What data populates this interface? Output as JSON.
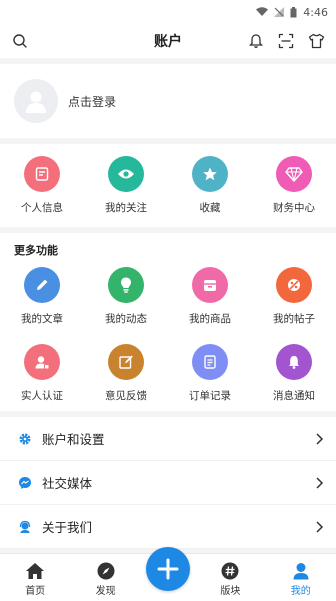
{
  "status_bar": {
    "time": "4:46"
  },
  "header": {
    "title": "账户"
  },
  "login": {
    "prompt": "点击登录"
  },
  "quick_items": [
    {
      "label": "个人信息",
      "icon": "profile-card-icon",
      "color": "#f36f7b"
    },
    {
      "label": "我的关注",
      "icon": "eye-icon",
      "color": "#26b89a"
    },
    {
      "label": "收藏",
      "icon": "star-icon",
      "color": "#4fb3c8"
    },
    {
      "label": "财务中心",
      "icon": "diamond-icon",
      "color": "#f05bb5"
    }
  ],
  "more": {
    "title": "更多功能",
    "row1": [
      {
        "label": "我的文章",
        "icon": "pencil-icon",
        "color": "#4a90e2"
      },
      {
        "label": "我的动态",
        "icon": "lightbulb-icon",
        "color": "#34b36b"
      },
      {
        "label": "我的商品",
        "icon": "shop-icon",
        "color": "#f06aa7"
      },
      {
        "label": "我的帖子",
        "icon": "post-icon",
        "color": "#f2683c"
      }
    ],
    "row2": [
      {
        "label": "实人认证",
        "icon": "person-badge-icon",
        "color": "#f36f7b"
      },
      {
        "label": "意见反馈",
        "icon": "edit-box-icon",
        "color": "#c9832e"
      },
      {
        "label": "订单记录",
        "icon": "receipt-icon",
        "color": "#7f8ef5"
      },
      {
        "label": "消息通知",
        "icon": "bell-icon",
        "color": "#a255cf"
      }
    ]
  },
  "list": [
    {
      "label": "账户和设置",
      "icon": "gear-icon"
    },
    {
      "label": "社交媒体",
      "icon": "messenger-icon"
    },
    {
      "label": "关于我们",
      "icon": "support-icon"
    }
  ],
  "tabs": [
    {
      "label": "首页",
      "icon": "home-icon"
    },
    {
      "label": "发现",
      "icon": "compass-icon"
    },
    {
      "label": "版块",
      "icon": "hashtag-icon"
    },
    {
      "label": "我的",
      "icon": "person-icon",
      "active": true
    }
  ],
  "accent_color": "#1e88e5"
}
